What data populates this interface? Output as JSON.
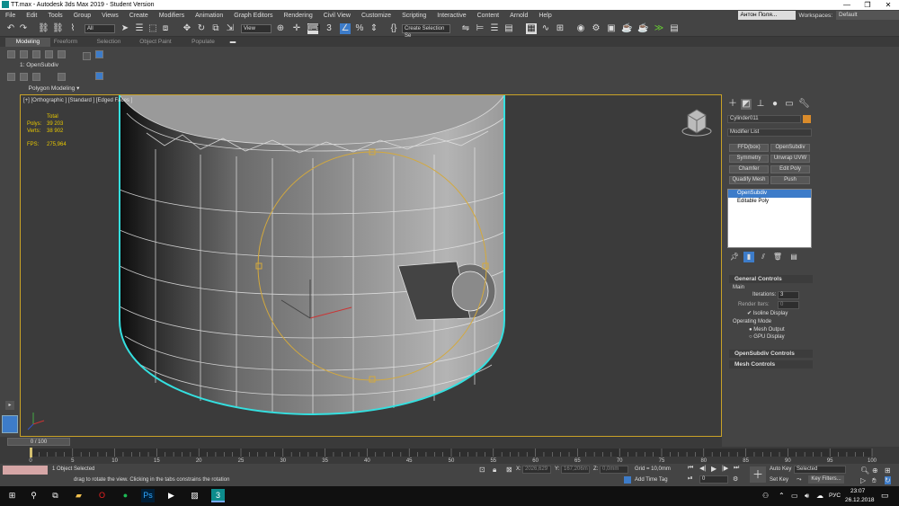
{
  "window": {
    "title": "TT.max - Autodesk 3ds Max 2019 - Student Version",
    "min": "—",
    "max": "❐",
    "close": "✕"
  },
  "menu": [
    "File",
    "Edit",
    "Tools",
    "Group",
    "Views",
    "Create",
    "Modifiers",
    "Animation",
    "Graph Editors",
    "Rendering",
    "Civil View",
    "Customize",
    "Scripting",
    "Interactive",
    "Content",
    "Arnold",
    "Help"
  ],
  "account": {
    "user": "Антон Поля...",
    "workspaces_label": "Workspaces:",
    "workspace": "Default"
  },
  "toolbar": {
    "filter": "All",
    "view": "View",
    "selection_set": "Create Selection Se"
  },
  "ribbon": {
    "tabs": [
      "Modeling",
      "Freeform",
      "Selection",
      "Object Paint",
      "Populate"
    ],
    "modifier": "1: OpenSubdiv",
    "panel_title": "Polygon Modeling ▾"
  },
  "viewport": {
    "label": "[+] [Orthographic ] [Standard ] [Edged Faces ]",
    "stats": {
      "total": "Total",
      "polys_label": "Polys:",
      "polys": "39 203",
      "verts_label": "Verts:",
      "verts": "38 902",
      "fps_label": "FPS:",
      "fps": "275,964"
    }
  },
  "command_panel": {
    "object_name": "Cylinder011",
    "modifier_list": "Modifier List",
    "buttons": [
      "FFD(box)",
      "OpenSubdiv",
      "Symmetry",
      "Unwrap UVW",
      "Chamfer",
      "Edit Poly",
      "Quadify Mesh",
      "Push"
    ],
    "stack": [
      "OpenSubdiv",
      "Editable Poly"
    ],
    "general_controls": "General Controls",
    "main": "Main",
    "iterations_label": "Iterations:",
    "iterations": "3",
    "render_iters_label": "Render Iters:",
    "render_iters": "0",
    "isoline": "Isoline Display",
    "operating_mode": "Operating Mode",
    "mesh_output": "Mesh Output",
    "gpu_display": "GPU Display",
    "opensubdiv_controls": "OpenSubdiv Controls",
    "mesh_controls": "Mesh Controls"
  },
  "timeline": {
    "slider": "0 / 100",
    "ticks": [
      "0",
      "5",
      "10",
      "15",
      "20",
      "25",
      "30",
      "35",
      "40",
      "45",
      "50",
      "55",
      "60",
      "65",
      "70",
      "75",
      "80",
      "85",
      "90",
      "95",
      "100"
    ]
  },
  "status": {
    "selected": "1 Object Selected",
    "prompt": "drag to rotate the view.  Clicking in the tabs constrains the rotation",
    "x_label": "X:",
    "x": "2026,629",
    "y_label": "Y:",
    "y": "167,206m",
    "z_label": "Z:",
    "z": "0,0mm",
    "grid": "Grid = 10,0mm",
    "add_time_tag": "Add Time Tag",
    "auto_key": "Auto Key",
    "selected_dd": "Selected",
    "set_key": "Set Key",
    "key_filters": "Key Filters...",
    "frame": "0"
  },
  "taskbar": {
    "lang": "РУС",
    "time": "23:07",
    "date": "26.12.2018"
  },
  "colors": {
    "accent": "#3d7cc9",
    "viewport_border": "#c9a227",
    "selection": "#34e0e0",
    "gizmo": "#d4a93c"
  }
}
